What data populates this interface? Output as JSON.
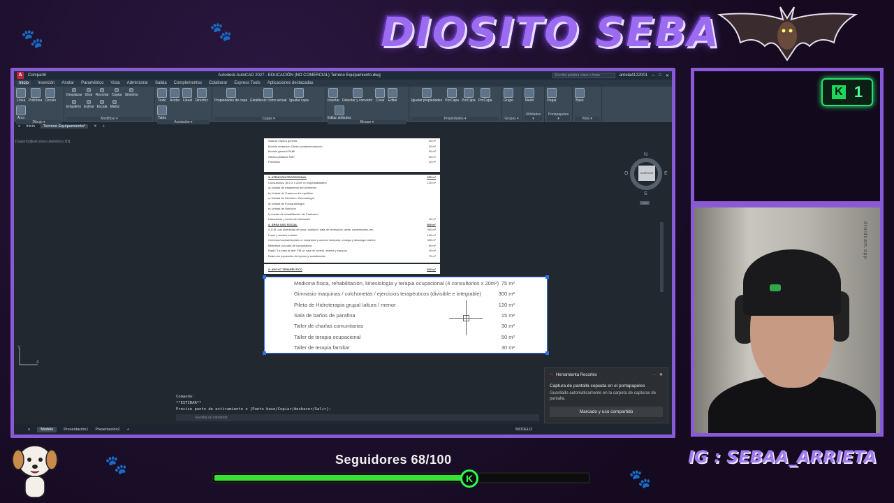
{
  "overlay": {
    "brand": "DIOSITO SEBA",
    "followers": {
      "label": "Seguidores 68/100",
      "current": 68,
      "goal": 100
    },
    "instagram": "IG : SEBAA_ARRIETA",
    "kick_badge": {
      "letter": "K",
      "count": "1"
    },
    "cam_watermark": "droidcam.app",
    "colors": {
      "frame": "#8a5ad6",
      "accent_green": "#37e234",
      "brand_purple": "#9b6cf0"
    }
  },
  "autocad": {
    "title_bar": {
      "title": "Autodesk AutoCAD 2027 - EDUCACIÓN (NO COMERCIAL)   Terreno Equipamiento.dwg",
      "share": "Compartir",
      "search_placeholder": "Escriba palabra clave o frase",
      "user": "arrieta4122001"
    },
    "ribbon_tabs": [
      "Inicio",
      "Inserción",
      "Anotar",
      "Paramétrico",
      "Vista",
      "Administrar",
      "Salida",
      "Complementos",
      "Colaborar",
      "Express Tools",
      "Aplicaciones destacadas"
    ],
    "panels": [
      {
        "name": "Dibujo",
        "tools": [
          "Línea",
          "Polilínea",
          "Círculo",
          "Arco"
        ]
      },
      {
        "name": "Modificar",
        "tools": [
          "Desplazar",
          "Girar",
          "Recortar",
          "Copiar",
          "Simetría",
          "Empalme",
          "Estirar",
          "Escala",
          "Matriz"
        ]
      },
      {
        "name": "Anotación",
        "tools": [
          "Texto",
          "Acotar",
          "Lineal",
          "Directriz",
          "Tabla"
        ]
      },
      {
        "name": "Capas",
        "tools": [
          "Propiedades de capa",
          "Establecer como actual",
          "Igualar capa"
        ]
      },
      {
        "name": "Bloque",
        "tools": [
          "Insertar",
          "Detectar y convertir",
          "Crear",
          "Editar",
          "Editar atributos"
        ]
      },
      {
        "name": "Propiedades",
        "tools": [
          "Igualar propiedades",
          "PorCapa",
          "PorCapa",
          "PorCapa"
        ]
      },
      {
        "name": "Grupos",
        "tools": [
          "Grupo"
        ]
      },
      {
        "name": "Utilidades",
        "tools": [
          "Medir"
        ]
      },
      {
        "name": "Portapapeles",
        "tools": [
          "Pegar"
        ]
      },
      {
        "name": "Vista",
        "tools": [
          "Base"
        ]
      }
    ],
    "file_tabs": [
      "Inicio",
      "Terreno Equipamiento*"
    ],
    "view_label": "[Superior][Estructura alámbrica 2D]",
    "viewcube": {
      "center": "SUPERIOR",
      "n": "N",
      "s": "S",
      "e": "E",
      "o": "O",
      "wcs": "SCU"
    },
    "sheet_top": [
      {
        "label": "Sala de espera general",
        "value": "50 m²"
      },
      {
        "label": "Módulo recepción Obras sociales/recepción",
        "value": "30 m²"
      },
      {
        "label": "Módulo general PAMI",
        "value": "30 m²"
      },
      {
        "label": "Oficina pileta/ue SAP",
        "value": "30 m²"
      },
      {
        "label": "Farmacia",
        "value": "20 m²"
      }
    ],
    "sheet_mid": [
      {
        "label": "3- ATENCIÓN PROFESIONAL",
        "value": "250 m²",
        "head": true
      },
      {
        "label": "Consultorios: (8 u.d. x 20m² en especialidades)",
        "value": "120 m²"
      },
      {
        "label": "a) Unidad de tratamiento del Alzheimer",
        "value": ""
      },
      {
        "label": "b) Unidad de Trastorno del equilibrio",
        "value": ""
      },
      {
        "label": "c) Unidad de Geriatría / Gerontología",
        "value": ""
      },
      {
        "label": "d) Unidad de Fonoaudiología",
        "value": ""
      },
      {
        "label": "e) Unidad de Nutrición",
        "value": ""
      },
      {
        "label": "f) Unidad de rehabilitación del Parkinson",
        "value": ""
      },
      {
        "label": "Laboratorio y boxes de extracción",
        "value": "40 m²"
      },
      {
        "label": "4- ÁREA USO SOCIAL",
        "value": "800 m²",
        "head": true
      },
      {
        "label": "S.U.M. con diversidad de usos, auditorio, sala de recreación, artes, conferencias, etc.",
        "value": "300 m²"
      },
      {
        "label": "Foyer y acceso exterior",
        "value": "100 m²"
      },
      {
        "label": "Comedor/cocina/depósito c/ expansión y acceso independ. c/carga y descarga exterior",
        "value": "300 m²"
      },
      {
        "label": "Biblioteca con sala de computación",
        "value": "60 m²"
      },
      {
        "label": "Radio \"La casa al aire\" FM (c/ sala de control, antena y equipos",
        "value": "30 m²"
      },
      {
        "label": "Estar con expansión de reposo y socialización",
        "value": "70 m²"
      }
    ],
    "sheet_head5": {
      "label": "5- APOYO TERAPÉUTICO",
      "value": "520 m²"
    },
    "selected_table": [
      {
        "label": "Medicina física, rehabilitación, kinesiología y terapia ocupacional (4 consultorios x 20m²)",
        "value": "75 m²"
      },
      {
        "label": "Gimnasio maquinas / colchonetas / ejercicios terapéuticos (divisible e integrable)",
        "value": "300 m²"
      },
      {
        "label": "Pileta de Hidroterapia grupal /altura / menor",
        "value": "120 m²"
      },
      {
        "label": "Sala de baños de parafina",
        "value": "15 m²"
      },
      {
        "label": "Taller de charlas comunitarias",
        "value": "30 m²"
      },
      {
        "label": "Taller de terapia ocupacional",
        "value": "50 m²"
      },
      {
        "label": "Taller de terapia familiar",
        "value": "30 m²"
      }
    ],
    "command_history": [
      "Comando:",
      "**ESTIRAR**",
      "Precise punto de estiramiento o [Punto base/Copiar/deshacer/Salir]:"
    ],
    "command_placeholder": "Escriba un comando",
    "layout_tabs": [
      "Modelo",
      "Presentación1",
      "Presentación2"
    ],
    "status_mode": "MODELO"
  },
  "toast": {
    "app": "Herramienta Recortes",
    "title": "Captura de pantalla copiada en el portapapeles",
    "body": "Guardado automáticamente en la carpeta de capturas de pantalla.",
    "button": "Marcado y uso compartido"
  }
}
